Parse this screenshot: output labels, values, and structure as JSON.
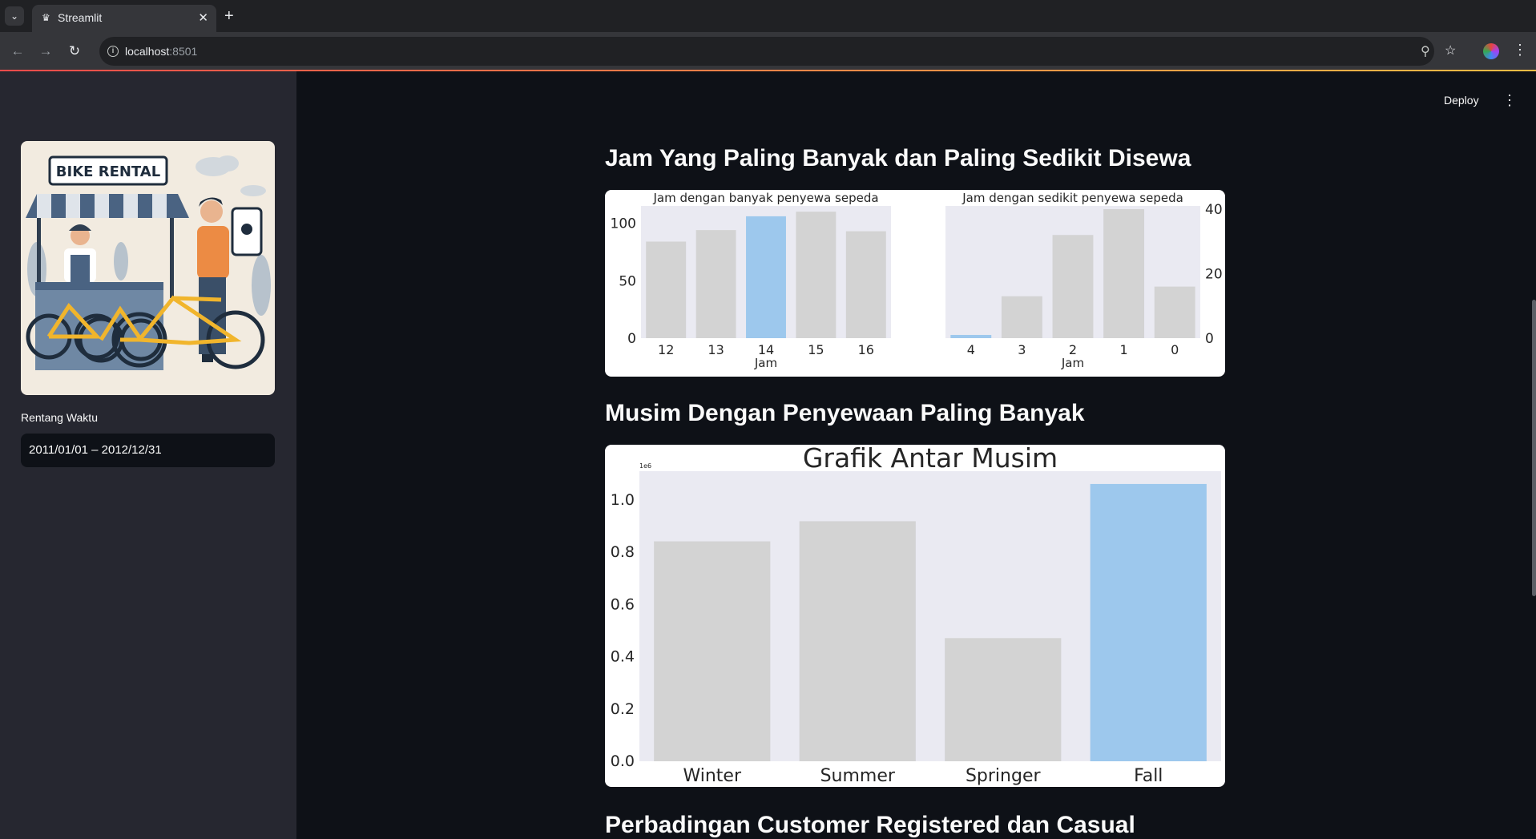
{
  "browser": {
    "tab_title": "Streamlit",
    "url_host": "localhost",
    "url_port": ":8501"
  },
  "sidebar": {
    "logo": {
      "sign_text": "BIKE RENTAL"
    },
    "date_label": "Rentang Waktu",
    "date_value": "2011/01/01 – 2012/12/31"
  },
  "header": {
    "deploy_label": "Deploy"
  },
  "sections": {
    "hours_title": "Jam Yang Paling Banyak dan Paling Sedikit Disewa",
    "season_title": "Musim Dengan Penyewaan Paling Banyak",
    "customer_title": "Perbadingan Customer Registered dan Casual"
  },
  "colors": {
    "highlight": "#9dc8ed",
    "default_bar": "#d3d3d3",
    "plot_bg": "#eaeaf2",
    "text": "#262626"
  },
  "chart_data": [
    {
      "type": "bar",
      "title": "Jam dengan banyak penyewa sepeda",
      "xlabel": "Jam",
      "ylabel": "",
      "categories": [
        "12",
        "13",
        "14",
        "15",
        "16"
      ],
      "values": [
        84,
        94,
        106,
        110,
        93
      ],
      "highlight_index": 2,
      "ylim": [
        0,
        115
      ],
      "yticks": [
        0,
        50,
        100
      ],
      "yaxis_side": "left"
    },
    {
      "type": "bar",
      "title": "Jam dengan sedikit penyewa sepeda",
      "xlabel": "Jam",
      "ylabel": "",
      "categories": [
        "4",
        "3",
        "2",
        "1",
        "0"
      ],
      "values": [
        1,
        13,
        32,
        40,
        16
      ],
      "highlight_index": 0,
      "ylim": [
        0,
        41
      ],
      "yticks": [
        0,
        20,
        40
      ],
      "yaxis_side": "right"
    },
    {
      "type": "bar",
      "title": "Grafik Antar Musim",
      "xlabel": "",
      "ylabel": "",
      "scale_label": "1e6",
      "categories": [
        "Winter",
        "Summer",
        "Springer",
        "Fall"
      ],
      "values": [
        841613,
        918589,
        471348,
        1061129
      ],
      "highlight_index": 3,
      "ylim": [
        0,
        1110000
      ],
      "yticks": [
        0.0,
        0.2,
        0.4,
        0.6,
        0.8,
        1.0
      ],
      "ytick_labels": [
        "0.0",
        "0.2",
        "0.4",
        "0.6",
        "0.8",
        "1.0"
      ]
    }
  ]
}
